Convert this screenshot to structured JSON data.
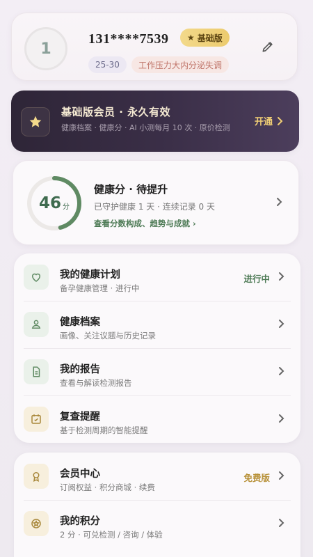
{
  "profile": {
    "avatar_text": "1",
    "phone": "131****7539",
    "tier_badge": "基础版",
    "age_tag": "25-30",
    "issue_tag": "工作压力大内分泌失调"
  },
  "member": {
    "title": "基础版会员 · 永久有效",
    "desc": "健康档案 · 健康分 · AI 小测每月 10 次 · 原价检测",
    "cta": "开通"
  },
  "score": {
    "value": "46",
    "unit": "分",
    "progress": 0.46,
    "title": "健康分 · 待提升",
    "subtitle": "已守护健康 1 天 · 连续记录 0 天",
    "link": "查看分数构成、趋势与成就 ›"
  },
  "menu": [
    {
      "title": "我的健康计划",
      "sub": "备孕健康管理 · 进行中",
      "status": "进行中",
      "status_color": "#4d7a55",
      "icon": "heart-icon"
    },
    {
      "title": "健康档案",
      "sub": "画像、关注议题与历史记录",
      "status": "",
      "icon": "person-icon"
    },
    {
      "title": "我的报告",
      "sub": "查看与解读检测报告",
      "status": "",
      "icon": "document-icon"
    },
    {
      "title": "复查提醒",
      "sub": "基于检测周期的智能提醒",
      "status": "",
      "icon": "calendar-icon"
    }
  ],
  "menu2": [
    {
      "title": "会员中心",
      "sub": "订阅权益 · 积分商城 · 续费",
      "status": "免费版",
      "status_color": "#b8923a",
      "icon": "badge-icon"
    },
    {
      "title": "我的积分",
      "sub": "2 分 · 可兑检测 / 咨询 / 体验",
      "status": "",
      "icon": "star-coin-icon"
    }
  ],
  "colors": {
    "accent_green": "#4d7a55",
    "gold": "#f1cf75",
    "banner_dark": "#2e2537"
  }
}
